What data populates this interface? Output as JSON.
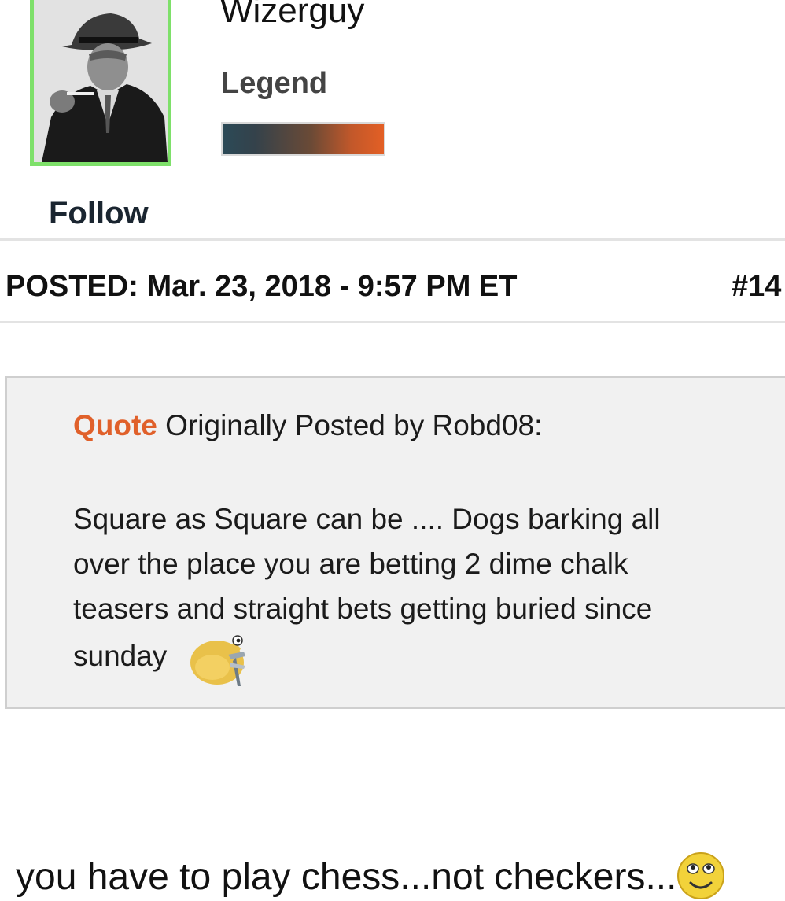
{
  "profile": {
    "username": "Wizerguy",
    "rank": "Legend",
    "follow_label": "Follow",
    "colors": {
      "avatar_border": "#7ee06a",
      "rank_bar_start": "#2c4a57",
      "rank_bar_end": "#e35f25"
    }
  },
  "post": {
    "posted_text": "POSTED: Mar. 23, 2018 - 9:57 PM ET",
    "post_number": "#14"
  },
  "quote": {
    "label": "Quote",
    "attribution": " Originally Posted by Robd08:",
    "lines": [
      "Square as Square can be .... Dogs barking all",
      "over the place you are betting 2 dime chalk",
      "teasers and straight bets getting buried since",
      "sunday"
    ],
    "emoji": "chick-emoji",
    "label_color": "#e0602a"
  },
  "reply": {
    "text": "you have to play chess...not checkers...",
    "emoji": "smiley-emoji"
  }
}
